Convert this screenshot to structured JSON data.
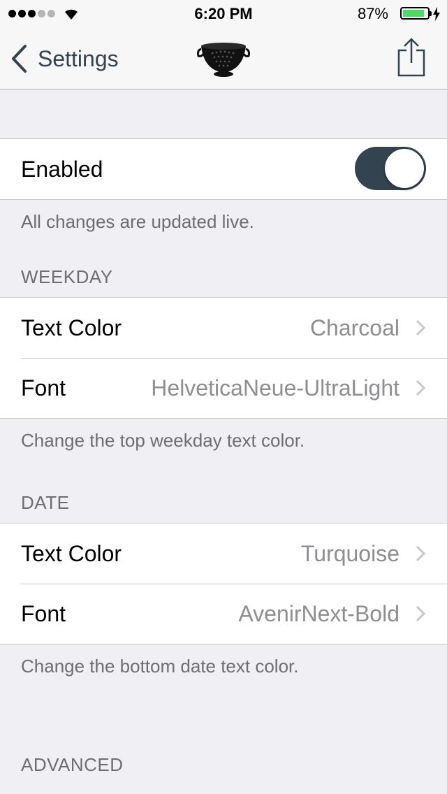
{
  "status_bar": {
    "time": "6:20 PM",
    "battery_percent": "87%",
    "battery_level": 0.87,
    "signal_bars_filled": 3,
    "signal_bars_total": 5
  },
  "nav": {
    "back_label": "Settings",
    "logo_icon": "colander-icon",
    "share_icon": "share-icon"
  },
  "enabled_section": {
    "label": "Enabled",
    "toggle_on": true,
    "toggle_color": "#344350",
    "footer": "All changes are updated live."
  },
  "weekday_section": {
    "header": "WEEKDAY",
    "rows": [
      {
        "label": "Text Color",
        "value": "Charcoal"
      },
      {
        "label": "Font",
        "value": "HelveticaNeue-UltraLight"
      }
    ],
    "footer": "Change the top weekday text color."
  },
  "date_section": {
    "header": "DATE",
    "rows": [
      {
        "label": "Text Color",
        "value": "Turquoise"
      },
      {
        "label": "Font",
        "value": "AvenirNext-Bold"
      }
    ],
    "footer": "Change the bottom date text color."
  },
  "advanced_section": {
    "header": "ADVANCED"
  },
  "colors": {
    "background": "#efeff4",
    "accent": "#344350",
    "battery": "#4cd964",
    "secondary_text": "#8e8e93"
  }
}
